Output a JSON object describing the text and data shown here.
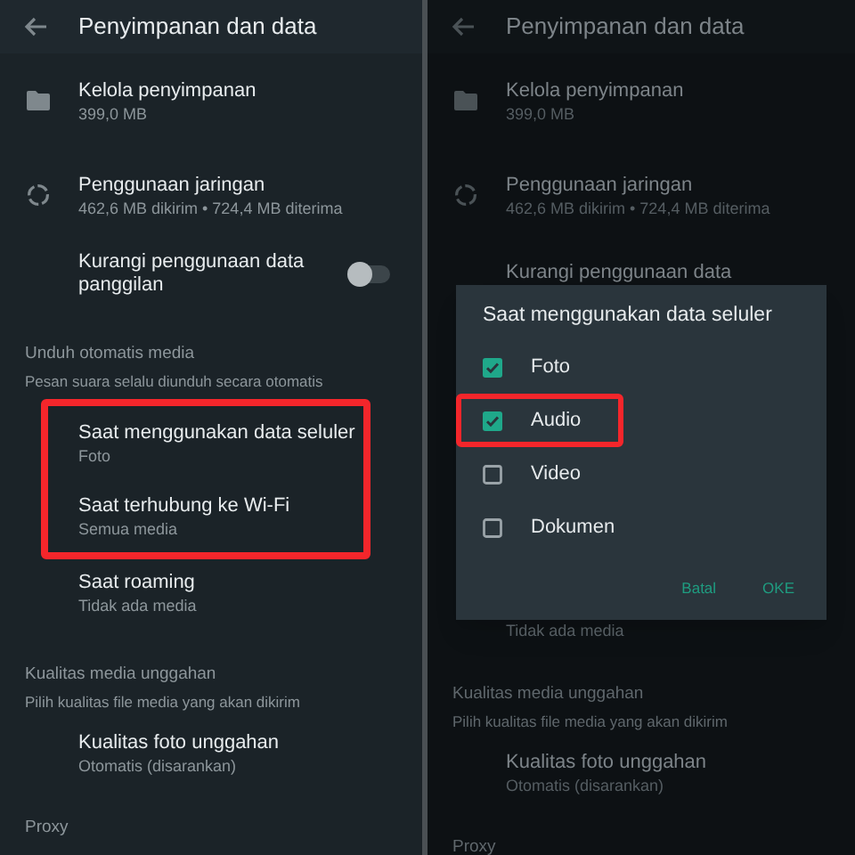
{
  "screens": [
    {
      "dimmed": false,
      "header": {
        "title": "Penyimpanan dan data"
      },
      "items": [
        {
          "kind": "folder_row",
          "title": "Kelola penyimpanan",
          "subtitle": "399,0 MB"
        },
        {
          "kind": "usage_row",
          "title": "Penggunaan jaringan",
          "subtitle": "462,6 MB dikirim • 724,4 MB diterima"
        },
        {
          "kind": "toggle_row",
          "title": "Kurangi penggunaan data panggilan",
          "on": false
        },
        {
          "kind": "section",
          "title": "Unduh otomatis media",
          "note": "Pesan suara selalu diunduh secara otomatis"
        },
        {
          "kind": "highlight_group",
          "highlighted": true,
          "rows": [
            {
              "title": "Saat menggunakan data seluler",
              "subtitle": "Foto"
            },
            {
              "title": "Saat terhubung ke Wi-Fi",
              "subtitle": "Semua media"
            }
          ]
        },
        {
          "kind": "row",
          "title": "Saat roaming",
          "subtitle": "Tidak ada media"
        },
        {
          "kind": "section",
          "title": "Kualitas media unggahan",
          "note": "Pilih kualitas file media yang akan dikirim"
        },
        {
          "kind": "row",
          "title": "Kualitas foto unggahan",
          "subtitle": "Otomatis (disarankan)"
        },
        {
          "kind": "section",
          "title": "Proxy"
        }
      ]
    },
    {
      "dimmed": true,
      "header": {
        "title": "Penyimpanan dan data"
      },
      "items": [
        {
          "kind": "folder_row",
          "title": "Kelola penyimpanan",
          "subtitle": "399,0 MB"
        },
        {
          "kind": "usage_row",
          "title": "Penggunaan jaringan",
          "subtitle": "462,6 MB dikirim • 724,4 MB diterima"
        },
        {
          "kind": "partial_title",
          "title": "Kurangi penggunaan data"
        },
        {
          "kind": "dialog",
          "title": "Saat menggunakan data seluler",
          "options": [
            {
              "label": "Foto",
              "checked": true,
              "highlighted": false
            },
            {
              "label": "Audio",
              "checked": true,
              "highlighted": true
            },
            {
              "label": "Video",
              "checked": false,
              "highlighted": false
            },
            {
              "label": "Dokumen",
              "checked": false,
              "highlighted": false
            }
          ],
          "buttons": [
            "Batal",
            "OKE"
          ]
        },
        {
          "kind": "partial_subtitle",
          "subtitle": "Tidak ada media"
        },
        {
          "kind": "section",
          "title": "Kualitas media unggahan",
          "note": "Pilih kualitas file media yang akan dikirim"
        },
        {
          "kind": "row",
          "title": "Kualitas foto unggahan",
          "subtitle": "Otomatis (disarankan)"
        },
        {
          "kind": "section",
          "title": "Proxy"
        }
      ]
    }
  ]
}
